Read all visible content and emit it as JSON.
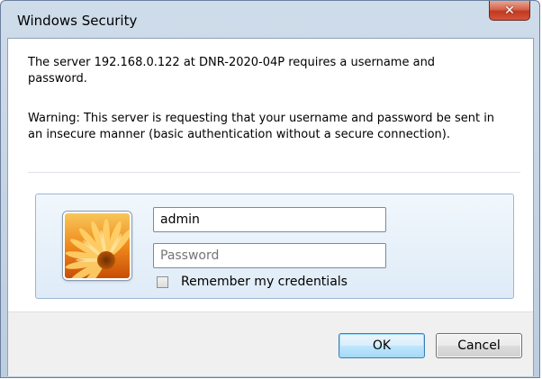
{
  "window": {
    "title": "Windows Security",
    "close_label": "✕"
  },
  "message": {
    "line1": "The server 192.168.0.122 at DNR-2020-04P requires a username and password.",
    "line2": "Warning: This server is requesting that your username and password be sent in an insecure manner (basic authentication without a secure connection)."
  },
  "credentials": {
    "username_value": "admin",
    "password_placeholder": "Password",
    "remember_label": "Remember my credentials",
    "remember_checked": false
  },
  "buttons": {
    "ok_label": "OK",
    "cancel_label": "Cancel"
  },
  "colors": {
    "close_button": "#c0391f",
    "ok_button_border": "#3c7fb1",
    "panel_border": "#9ab6d3"
  },
  "icons": {
    "avatar": "user-avatar-flower-icon",
    "close": "close-icon"
  }
}
